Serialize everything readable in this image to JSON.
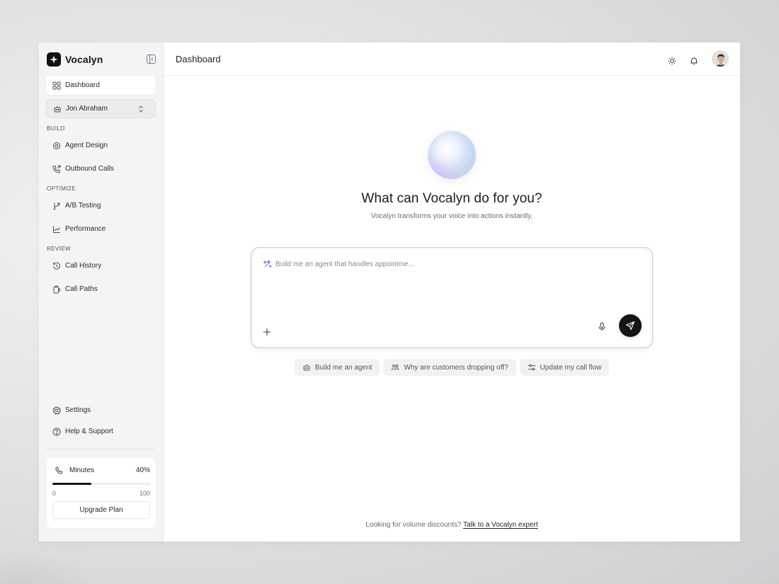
{
  "app": {
    "name": "Vocalyn"
  },
  "sidebar": {
    "dashboard": "Dashboard",
    "workspace_select": "Jon Abraham",
    "sections": {
      "build": "BUILD",
      "optimize": "OPTIMIZE",
      "review": "REVIEW"
    },
    "items": {
      "agent_design": "Agent Design",
      "outbound_calls": "Outbound Calls",
      "ab_testing": "A/B Testing",
      "performance": "Performance",
      "call_history": "Call History",
      "call_paths": "Call Paths"
    },
    "bottom": {
      "settings": "Settings",
      "help": "Help & Support"
    },
    "usage": {
      "label": "Minutes",
      "percent_label": "40%",
      "progress": 0.4,
      "min": "0",
      "max": "100",
      "upgrade_label": "Upgrade Plan"
    }
  },
  "header": {
    "title": "Dashboard"
  },
  "hero": {
    "title": "What can Vocalyn do for you?",
    "subtitle": "Vocalyn transforms your voice into actions instantly."
  },
  "prompt": {
    "placeholder": "Build me an agent that handles appointme..."
  },
  "suggestions": [
    "Build me an agent",
    "Why are customers dropping off?",
    "Update my call flow"
  ],
  "footer": {
    "text": "Looking for volume discounts?",
    "link": "Talk to a Vocalyn expert"
  },
  "icons": {
    "logo": "diamond-star-logo",
    "collapse": "sidebar-collapse-icon",
    "theme": "sun-icon",
    "notifications": "bell-icon",
    "mic": "microphone-icon",
    "send": "send-icon",
    "attach": "plus-icon",
    "sparkle": "sparkle-icon"
  },
  "colors": {
    "accent": "#151517",
    "sidebar_bg": "#f4f4f6",
    "sparkle": "#8b5cf6"
  }
}
